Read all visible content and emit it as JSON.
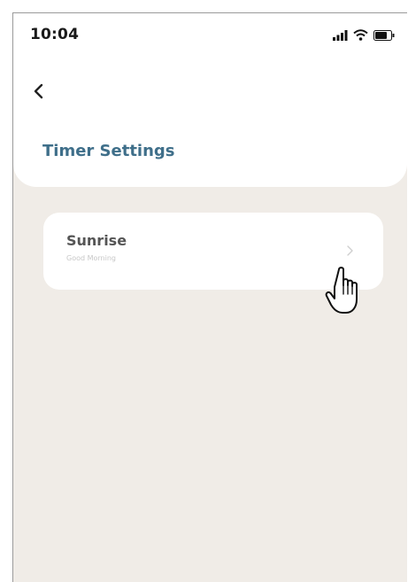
{
  "status_bar": {
    "time": "10:04",
    "icons": [
      "signal-icon",
      "wifi-icon",
      "battery-icon"
    ]
  },
  "header": {
    "back_icon": "back-chevron-icon",
    "title": "Timer Settings"
  },
  "timers": [
    {
      "name": "Sunrise",
      "subtitle": "Good Morning",
      "icon": "chevron-right-icon"
    }
  ],
  "overlay": {
    "pointer_icon": "hand-pointer-cursor-icon"
  },
  "colors": {
    "title_accent": "#3f6f8a",
    "background": "#f0ece7",
    "card": "#ffffff"
  }
}
